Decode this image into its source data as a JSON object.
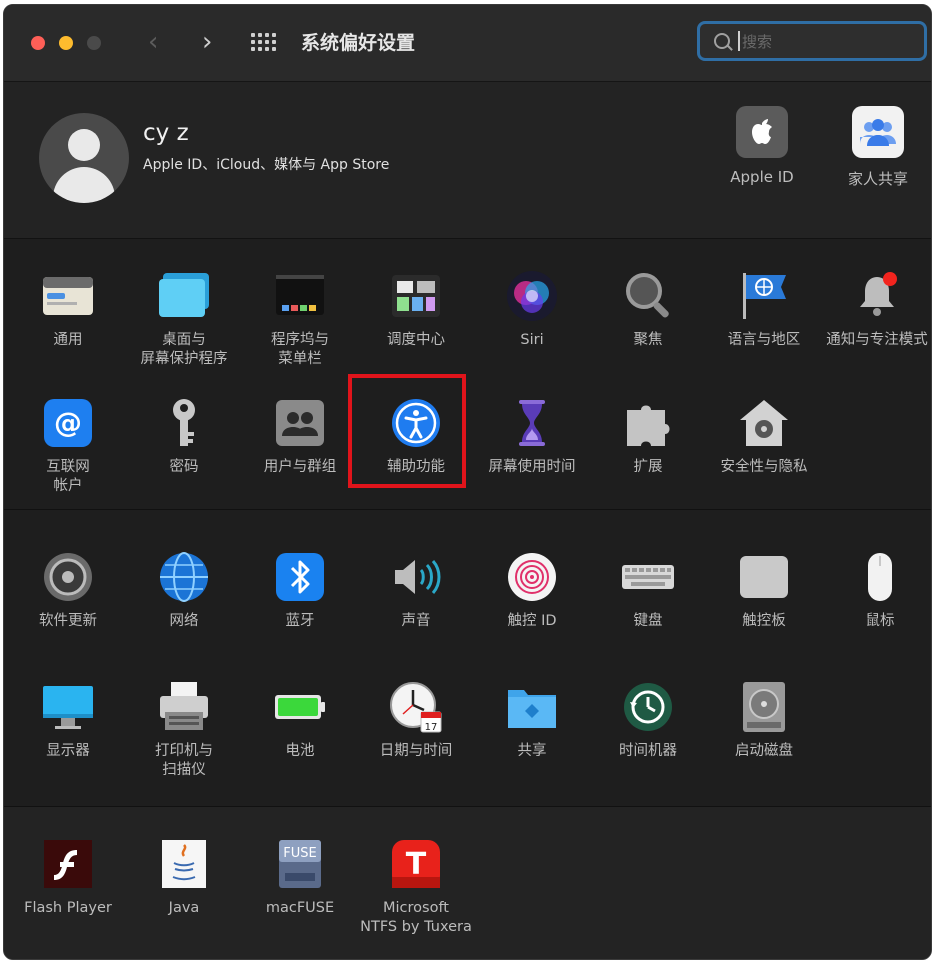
{
  "window": {
    "title": "系统偏好设置"
  },
  "toolbar": {
    "back_icon": "chevron-left-icon",
    "forward_icon": "chevron-right-icon",
    "grid_icon": "show-all-grid-icon"
  },
  "search": {
    "placeholder": "搜索",
    "value": ""
  },
  "account": {
    "name": "cy z",
    "subtitle": "Apple ID、iCloud、媒体与 App Store",
    "apple_id_label": "Apple ID",
    "family_label": "家人共享"
  },
  "sections": {
    "personal": {
      "items": [
        {
          "label": "通用",
          "icon": "general-icon"
        },
        {
          "label": "桌面与\n屏幕保护程序",
          "icon": "desktop-screensaver-icon"
        },
        {
          "label": "程序坞与\n菜单栏",
          "icon": "dock-menubar-icon"
        },
        {
          "label": "调度中心",
          "icon": "mission-control-icon"
        },
        {
          "label": "Siri",
          "icon": "siri-icon"
        },
        {
          "label": "聚焦",
          "icon": "spotlight-icon"
        },
        {
          "label": "语言与地区",
          "icon": "language-region-icon"
        },
        {
          "label": "通知与专注模式",
          "icon": "notifications-icon"
        },
        {
          "label": "互联网\n帐户",
          "icon": "internet-accounts-icon"
        },
        {
          "label": "密码",
          "icon": "passwords-key-icon"
        },
        {
          "label": "用户与群组",
          "icon": "users-groups-icon"
        },
        {
          "label": "辅助功能",
          "icon": "accessibility-icon"
        },
        {
          "label": "屏幕使用时间",
          "icon": "screen-time-hourglass-icon"
        },
        {
          "label": "扩展",
          "icon": "extensions-puzzle-icon"
        },
        {
          "label": "安全性与隐私",
          "icon": "security-privacy-house-icon"
        }
      ]
    },
    "hardware": {
      "items": [
        {
          "label": "软件更新",
          "icon": "software-update-gear-icon"
        },
        {
          "label": "网络",
          "icon": "network-globe-icon"
        },
        {
          "label": "蓝牙",
          "icon": "bluetooth-icon"
        },
        {
          "label": "声音",
          "icon": "sound-speaker-icon"
        },
        {
          "label": "触控 ID",
          "icon": "touch-id-fingerprint-icon"
        },
        {
          "label": "键盘",
          "icon": "keyboard-icon"
        },
        {
          "label": "触控板",
          "icon": "trackpad-icon"
        },
        {
          "label": "鼠标",
          "icon": "mouse-icon"
        },
        {
          "label": "显示器",
          "icon": "displays-monitor-icon"
        },
        {
          "label": "打印机与\n扫描仪",
          "icon": "printers-scanners-icon"
        },
        {
          "label": "电池",
          "icon": "battery-icon"
        },
        {
          "label": "日期与时间",
          "icon": "date-time-clock-icon"
        },
        {
          "label": "共享",
          "icon": "sharing-folder-icon"
        },
        {
          "label": "时间机器",
          "icon": "time-machine-icon"
        },
        {
          "label": "启动磁盘",
          "icon": "startup-disk-icon"
        }
      ]
    },
    "other": {
      "items": [
        {
          "label": "Flash Player",
          "icon": "flash-player-icon"
        },
        {
          "label": "Java",
          "icon": "java-icon"
        },
        {
          "label": "macFUSE",
          "icon": "macfuse-icon"
        },
        {
          "label": "Microsoft\nNTFS by Tuxera",
          "icon": "tuxera-ntfs-icon"
        }
      ]
    }
  },
  "icon_text": {
    "fuse": "FUSE",
    "tuxera": "T",
    "calendar": "17"
  },
  "highlight": {
    "target": "辅助功能",
    "color": "#e0141b"
  }
}
